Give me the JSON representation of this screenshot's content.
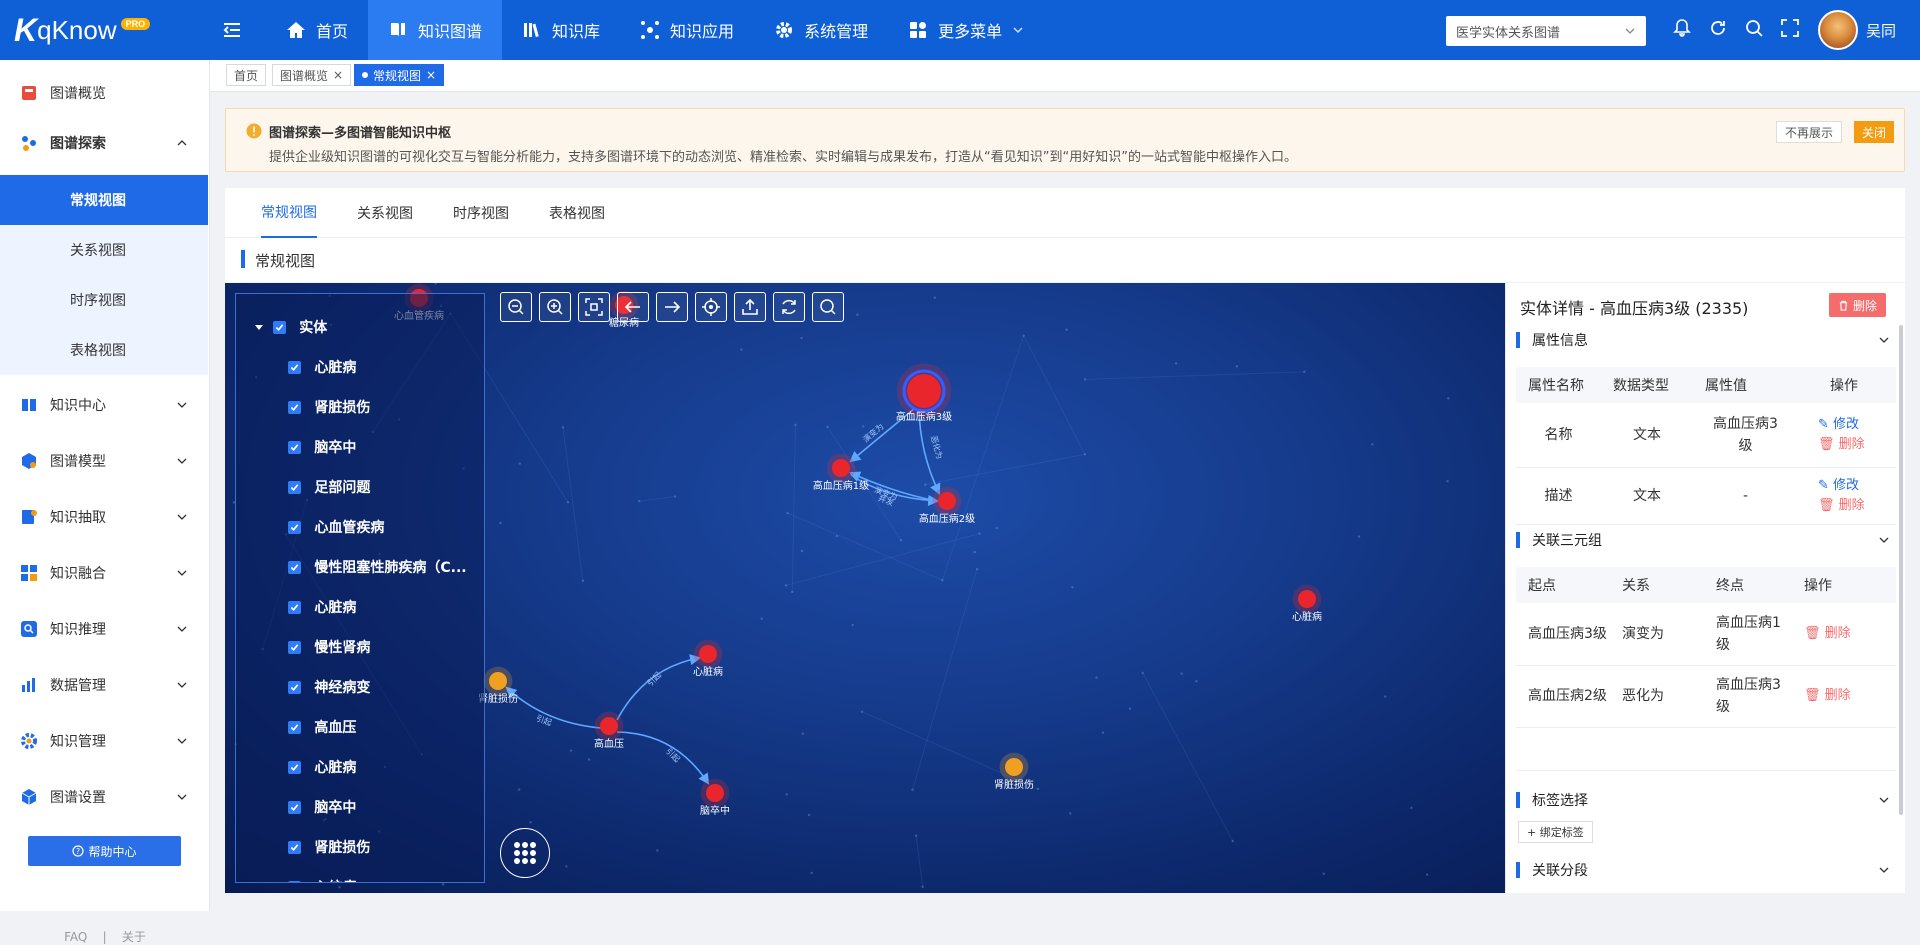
{
  "app": {
    "brand_k": "K",
    "brand_name": "qKnow",
    "brand_badge": "PRO"
  },
  "nav": {
    "items": [
      {
        "label": "首页",
        "icon": "home-icon"
      },
      {
        "label": "知识图谱",
        "icon": "book-icon",
        "active": true
      },
      {
        "label": "知识库",
        "icon": "library-icon"
      },
      {
        "label": "知识应用",
        "icon": "application-icon"
      },
      {
        "label": "系统管理",
        "icon": "gear-icon"
      },
      {
        "label": "更多菜单",
        "icon": "grid-menu-icon"
      }
    ],
    "graph_select": "医学实体关系图谱",
    "username": "吴同"
  },
  "sidebar": {
    "items": [
      {
        "label": "图谱概览",
        "icon": "overview-icon"
      },
      {
        "label": "图谱探索",
        "icon": "explore-icon",
        "expanded": true
      },
      {
        "label": "知识中心",
        "icon": "knowledge-center-icon"
      },
      {
        "label": "图谱模型",
        "icon": "model-icon"
      },
      {
        "label": "知识抽取",
        "icon": "extract-icon"
      },
      {
        "label": "知识融合",
        "icon": "fusion-icon"
      },
      {
        "label": "知识推理",
        "icon": "reasoning-icon"
      },
      {
        "label": "数据管理",
        "icon": "data-icon"
      },
      {
        "label": "知识管理",
        "icon": "manage-icon"
      },
      {
        "label": "图谱设置",
        "icon": "settings-icon"
      }
    ],
    "subitems": [
      "常规视图",
      "关系视图",
      "时序视图",
      "表格视图"
    ],
    "help": "帮助中心",
    "faq": "FAQ",
    "divider": "|",
    "about": "关于"
  },
  "tags": [
    {
      "label": "首页"
    },
    {
      "label": "图谱概览",
      "close": "×"
    },
    {
      "label": "常规视图",
      "close": "×",
      "active": true
    }
  ],
  "notice": {
    "title": "图谱探索—多图谱智能知识中枢",
    "text": "提供企业级知识图谱的可视化交互与智能分析能力，支持多图谱环境下的动态浏览、精准检索、实时编辑与成果发布，打造从“看见知识”到“用好知识”的一站式智能中枢操作入口。",
    "no_more": "不再展示",
    "close": "关闭"
  },
  "tabs": [
    "常规视图",
    "关系视图",
    "时序视图",
    "表格视图"
  ],
  "section_title": "常规视图",
  "tree": {
    "root": "实体",
    "items": [
      "心脏病",
      "肾脏损伤",
      "脑卒中",
      "足部问题",
      "心血管疾病",
      "慢性阻塞性肺疾病（C...",
      "心脏病",
      "慢性肾病",
      "神经病变",
      "高血压",
      "心脏病",
      "脑卒中",
      "肾脏损伤",
      "心绞痛"
    ]
  },
  "graph": {
    "nodes": [
      {
        "label": "高血压病3级",
        "color": "#e8262b",
        "selected": true
      },
      {
        "label": "高血压病1级",
        "color": "#e8262b"
      },
      {
        "label": "高血压病2级",
        "color": "#e8262b"
      },
      {
        "label": "心脏病",
        "color": "#e8262b"
      },
      {
        "label": "高血压",
        "color": "#e8262b"
      },
      {
        "label": "心脏病",
        "color": "#e8262b"
      },
      {
        "label": "肾脏损伤",
        "color": "#f0a020"
      },
      {
        "label": "脑卒中",
        "color": "#e8262b"
      },
      {
        "label": "肾脏损伤",
        "color": "#f0a020"
      },
      {
        "label": "心血管疾病",
        "color": "#e8262b"
      },
      {
        "label": "糖尿病",
        "color": "#e8262b"
      }
    ],
    "edges": [
      {
        "label": "演变为"
      },
      {
        "label": "恶化为"
      },
      {
        "label": "演变为"
      },
      {
        "label": "并发"
      },
      {
        "label": "引起"
      },
      {
        "label": "引起"
      },
      {
        "label": "引起"
      }
    ]
  },
  "detail": {
    "title": "实体详情 - 高血压病3级 (2335)",
    "delete": "删除",
    "attr_section": "属性信息",
    "attr_headers": [
      "属性名称",
      "数据类型",
      "属性值",
      "操作"
    ],
    "attrs": [
      {
        "name": "名称",
        "type": "文本",
        "value": "高血压病3级"
      },
      {
        "name": "描述",
        "type": "文本",
        "value": "-"
      }
    ],
    "edit": "修改",
    "remove": "删除",
    "triple_section": "关联三元组",
    "triple_headers": [
      "起点",
      "关系",
      "终点",
      "操作"
    ],
    "triples": [
      {
        "from": "高血压病3级",
        "rel": "演变为",
        "to": "高血压病1级"
      },
      {
        "from": "高血压病2级",
        "rel": "恶化为",
        "to": "高血压病3级"
      }
    ],
    "tag_section": "标签选择",
    "bind_tag": "+ 绑定标签",
    "segment_section": "关联分段"
  }
}
